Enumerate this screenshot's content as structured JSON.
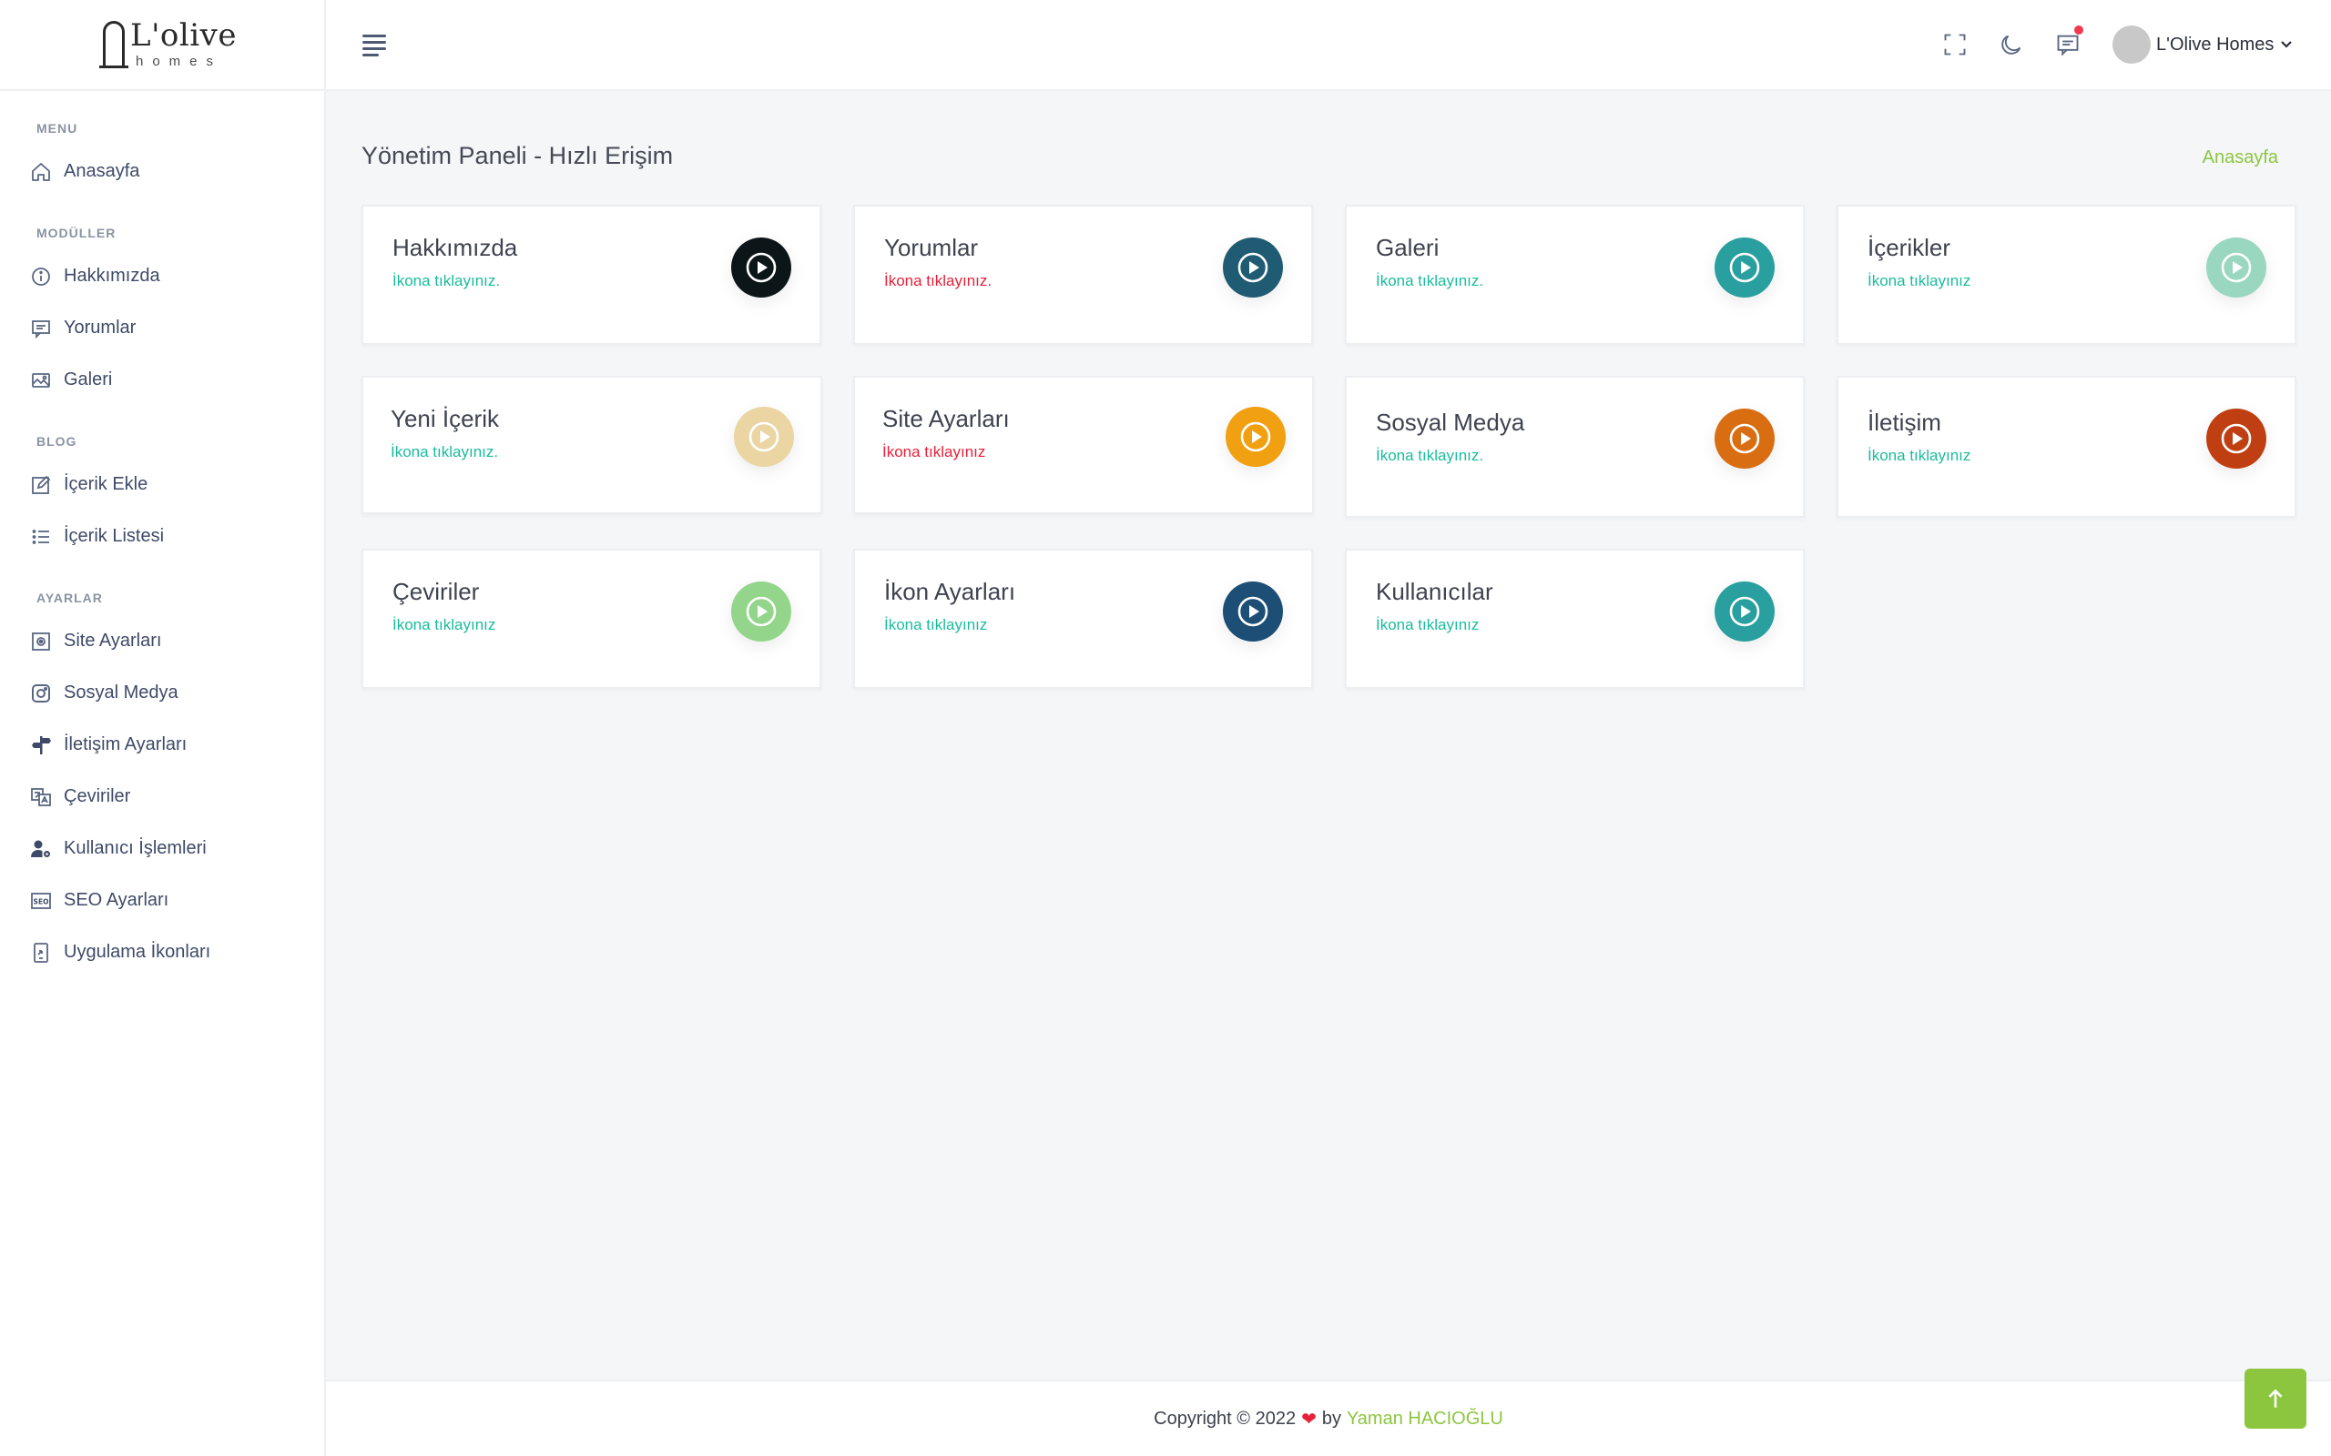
{
  "brand": {
    "name": "L'olive",
    "sub": "homes"
  },
  "sidebar": {
    "sections": [
      {
        "title": "MENU",
        "items": [
          {
            "label": "Anasayfa",
            "icon": "home-icon"
          }
        ]
      },
      {
        "title": "MODÜLLER",
        "items": [
          {
            "label": "Hakkımızda",
            "icon": "info-icon"
          },
          {
            "label": "Yorumlar",
            "icon": "comment-icon"
          },
          {
            "label": "Galeri",
            "icon": "gallery-icon"
          }
        ]
      },
      {
        "title": "BLOG",
        "items": [
          {
            "label": "İçerik Ekle",
            "icon": "edit-icon"
          },
          {
            "label": "İçerik Listesi",
            "icon": "list-icon"
          }
        ]
      },
      {
        "title": "AYARLAR",
        "items": [
          {
            "label": "Site Ayarları",
            "icon": "settings-box-icon"
          },
          {
            "label": "Sosyal Medya",
            "icon": "instagram-icon"
          },
          {
            "label": "İletişim Ayarları",
            "icon": "signpost-icon"
          },
          {
            "label": "Çeviriler",
            "icon": "translate-icon"
          },
          {
            "label": "Kullanıcı İşlemleri",
            "icon": "user-cog-icon"
          },
          {
            "label": "SEO Ayarları",
            "icon": "seo-icon"
          },
          {
            "label": "Uygulama İkonları",
            "icon": "app-icon"
          }
        ]
      }
    ]
  },
  "topbar": {
    "user_name": "L'Olive Homes"
  },
  "page": {
    "title": "Yönetim Paneli - Hızlı Erişim",
    "breadcrumb": "Anasayfa"
  },
  "cards": [
    {
      "title": "Hakkımızda",
      "subtitle": "İkona tıklayınız.",
      "sub_color": "#1abc9c",
      "btn_color": "#0c1518"
    },
    {
      "title": "Yorumlar",
      "subtitle": "İkona tıklayınız.",
      "sub_color": "#e8203a",
      "btn_color": "#1f5b73"
    },
    {
      "title": "Galeri",
      "subtitle": "İkona tıklayınız.",
      "sub_color": "#1abc9c",
      "btn_color": "#2a9fa0"
    },
    {
      "title": "İçerikler",
      "subtitle": "İkona tıklayınız",
      "sub_color": "#1abc9c",
      "btn_color": "#9ad7c0"
    },
    {
      "title": "Yeni İçerik",
      "subtitle": "İkona tıklayınız.",
      "sub_color": "#1abc9c",
      "btn_color": "#ead5a3"
    },
    {
      "title": "Site Ayarları",
      "subtitle": "İkona tıklayınız",
      "sub_color": "#e8203a",
      "btn_color": "#f0a010"
    },
    {
      "title": "Sosyal Medya",
      "subtitle": "İkona tıklayınız.",
      "sub_color": "#1abc9c",
      "btn_color": "#d96d12"
    },
    {
      "title": "İletişim",
      "subtitle": "İkona tıklayınız",
      "sub_color": "#1abc9c",
      "btn_color": "#bf3f12"
    },
    {
      "title": "Çeviriler",
      "subtitle": "İkona tıklayınız",
      "sub_color": "#1abc9c",
      "btn_color": "#93d58a"
    },
    {
      "title": "İkon Ayarları",
      "subtitle": "İkona tıklayınız",
      "sub_color": "#1abc9c",
      "btn_color": "#1c4e76"
    },
    {
      "title": "Kullanıcılar",
      "subtitle": "İkona tıklayınız",
      "sub_color": "#1abc9c",
      "btn_color": "#2a9fa0"
    }
  ],
  "footer": {
    "copyright": "Copyright © 2022",
    "heart": "❤",
    "by": "by",
    "author": "Yaman HACIOĞLU"
  },
  "colors": {
    "accent": "#8cc63f",
    "danger": "#e8203a",
    "teal": "#1abc9c"
  }
}
